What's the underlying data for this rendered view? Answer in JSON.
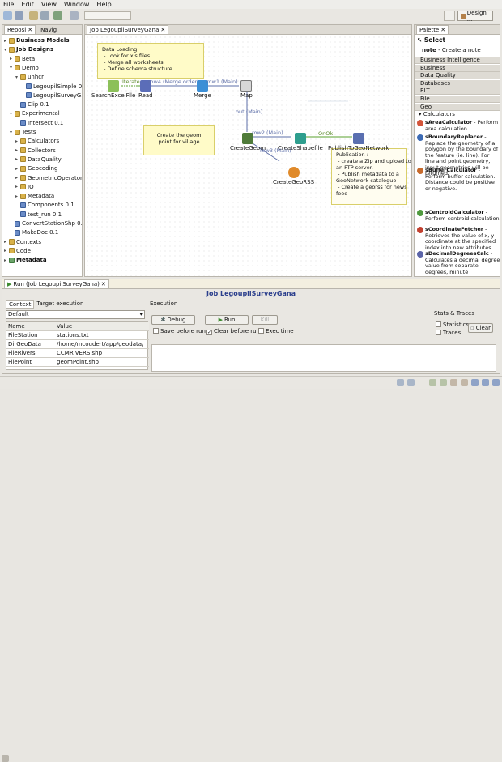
{
  "menu": [
    "File",
    "Edit",
    "View",
    "Window",
    "Help"
  ],
  "toolbar": {
    "design_label": "Design ..."
  },
  "repo": {
    "tabs": [
      "Reposi",
      "Navig"
    ],
    "tree": [
      {
        "label": "Business Models",
        "bold": true,
        "type": "f",
        "indent": 0
      },
      {
        "label": "Job Designs",
        "bold": true,
        "type": "f",
        "indent": 0,
        "open": true
      },
      {
        "label": "Beta",
        "type": "f",
        "indent": 1
      },
      {
        "label": "Demo",
        "type": "f",
        "indent": 1,
        "open": true
      },
      {
        "label": "unhcr",
        "type": "f",
        "indent": 2,
        "open": true
      },
      {
        "label": "LegoupilSimple 0.",
        "type": "j",
        "indent": 3
      },
      {
        "label": "LegoupilSurveyGa",
        "type": "j",
        "indent": 3
      },
      {
        "label": "Clip 0.1",
        "type": "j",
        "indent": 2
      },
      {
        "label": "Experimental",
        "type": "f",
        "indent": 1,
        "open": true
      },
      {
        "label": "Intersect 0.1",
        "type": "j",
        "indent": 2
      },
      {
        "label": "Tests",
        "type": "f",
        "indent": 1,
        "open": true
      },
      {
        "label": "Calculators",
        "type": "f",
        "indent": 2
      },
      {
        "label": "Collectors",
        "type": "f",
        "indent": 2
      },
      {
        "label": "DataQuality",
        "type": "f",
        "indent": 2
      },
      {
        "label": "Geocoding",
        "type": "f",
        "indent": 2
      },
      {
        "label": "GeometricOperators",
        "type": "f",
        "indent": 2
      },
      {
        "label": "IO",
        "type": "f",
        "indent": 2
      },
      {
        "label": "Metadata",
        "type": "f",
        "indent": 2
      },
      {
        "label": "Components 0.1",
        "type": "j",
        "indent": 2
      },
      {
        "label": "test_run 0.1",
        "type": "j",
        "indent": 2
      },
      {
        "label": "ConvertStationShp 0.1",
        "type": "j",
        "indent": 1
      },
      {
        "label": "MakeDoc 0.1",
        "type": "j",
        "indent": 1
      },
      {
        "label": "Contexts",
        "type": "f",
        "indent": 0
      },
      {
        "label": "Code",
        "type": "f",
        "indent": 0
      },
      {
        "label": "Metadata",
        "bold": true,
        "type": "d",
        "indent": 0
      }
    ]
  },
  "editor": {
    "tab": "Job LegoupilSurveyGana",
    "notes": [
      "Data Loading\n - Look for xls files\n - Merge all worksheets\n - Define schema structure",
      "Create the geom\npoint for village",
      "Publication :\n - create a Zip and upload to\nan FTP server.\n - Publish metadata to a\nGeoNetwork catalogue\n - Create a georss for news\nfeed"
    ],
    "components": [
      "SearchExcelFile",
      "Read",
      "Merge",
      "Map",
      "CreateGeom",
      "CreateShapefile",
      "PublishToGeoNetwork",
      "CreateGeoRSS"
    ],
    "links": [
      "Iterate",
      "row4 (Merge order)",
      "row1 (Main)",
      "out (Main)",
      "row2 (Main)",
      "OnOk",
      "row3 (Main)"
    ]
  },
  "palette": {
    "tab": "Palette",
    "select": "Select",
    "note_item": "note",
    "note_desc": "- Create a note",
    "groups": [
      "Business Intelligence",
      "Business",
      "Data Quality",
      "Databases",
      "ELT",
      "File",
      "Geo"
    ],
    "calculators": "Calculators",
    "items": [
      {
        "name": "sAreaCalculator",
        "desc": "- Perform area calculation"
      },
      {
        "name": "sBoundaryReplacer",
        "desc": "- Replace the geometry of a polygon by the boundary of the feature (ie. line). For line and point geometry, input geometries will be returned."
      },
      {
        "name": "sBufferCalculator",
        "desc": "- Perform buffer calculation. Distance could be positive or negative."
      },
      {
        "name": "sCentroidCalculator",
        "desc": "- Perform centroid calculation"
      },
      {
        "name": "sCoordinateFetcher",
        "desc": "- Retrieves the value of x, y coordinate at the specified index into new attributes"
      },
      {
        "name": "sDecimalDegreesCalc",
        "desc": "- Calculates a decimal degree value from separate degrees, minute"
      }
    ]
  },
  "run": {
    "tab": "Run (Job LegoupilSurveyGana)",
    "title": "Job LegoupilSurveyGana",
    "context_tabs": [
      "Context",
      "Target execution"
    ],
    "context_select": "Default",
    "col_name": "Name",
    "col_value": "Value",
    "rows": [
      {
        "name": "FileStation",
        "value": "stations.txt"
      },
      {
        "name": "DirGeoData",
        "value": "/home/mcoudert/app/geodata/"
      },
      {
        "name": "FileRivers",
        "value": "CCMRIVERS.shp"
      },
      {
        "name": "FilePoint",
        "value": "geomPoint.shp"
      }
    ],
    "execution_label": "Execution",
    "debug": "Debug",
    "run": "Run",
    "kill": "Kill",
    "save_before_run": "Save before run",
    "clear_before_run": "Clear before run",
    "exec_time": "Exec time",
    "stats_label": "Stats & Traces",
    "statistics": "Statistics",
    "traces": "Traces",
    "clear": "Clear"
  }
}
